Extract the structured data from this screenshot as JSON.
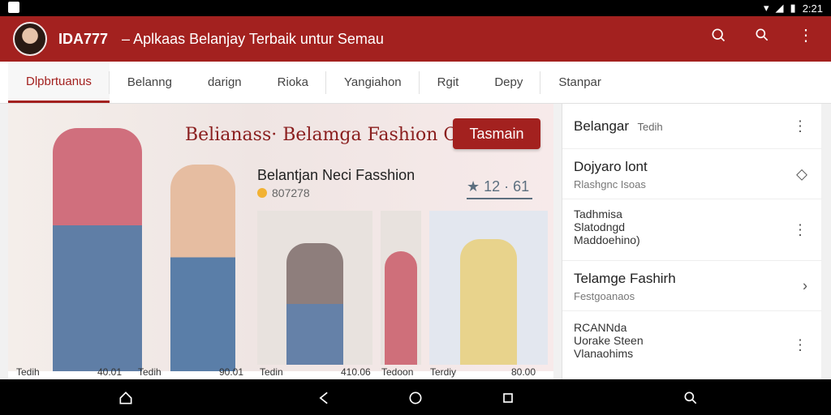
{
  "status_bar": {
    "time": "2:21"
  },
  "app_bar": {
    "brand": "IDA777",
    "subtitle": "– Aplkaas Belanjay Terbaik untur Semau",
    "icons": [
      "search-icon",
      "search-icon",
      "more-vert-icon"
    ]
  },
  "tabs": [
    {
      "label": "Dlpbrtuanus"
    },
    {
      "label": "Belanng"
    },
    {
      "label": "darign"
    },
    {
      "label": "Rioka"
    },
    {
      "label": "Yangiahon"
    },
    {
      "label": "Rgit"
    },
    {
      "label": "Depy"
    },
    {
      "label": "Stanpar"
    }
  ],
  "hero": {
    "headline": "Belianass· Belamga Fashion Chomi",
    "cta": "Tasmain",
    "subtitle": "Belantjan Neci Fasshion",
    "meta": "807278",
    "rating": "12 · 61"
  },
  "product_labels": [
    {
      "name": "Tedih",
      "price": "40.01"
    },
    {
      "name": "Tedih",
      "price": "90.01"
    },
    {
      "name": "Tedin",
      "price": "410.06"
    },
    {
      "name": "Tedoon",
      "price": ""
    },
    {
      "name": "Terdiy",
      "price": "80.00"
    }
  ],
  "right_list": [
    {
      "title": "Belangar",
      "title_suffix": "Tedih",
      "sub": "",
      "icon": "more-vert-icon"
    },
    {
      "title": "Dojyaro lont",
      "sub": "Rlashgnc Isoas",
      "icon": "diamond-icon"
    },
    {
      "title": "Tadhmisa",
      "sub": "Slatodngd\nMaddoehino)",
      "icon": "more-vert-icon"
    },
    {
      "title": "Telamge Fashirh",
      "sub": "Festgoanaos",
      "icon": "chevron-right-icon"
    },
    {
      "title": "RCANNda",
      "sub": "Uorake Steen\nVlanaohims",
      "icon": "more-vert-icon"
    }
  ],
  "nav": {
    "icons": [
      "home-icon",
      "back-icon",
      "home-circle-icon",
      "recents-icon",
      "search-icon"
    ]
  }
}
